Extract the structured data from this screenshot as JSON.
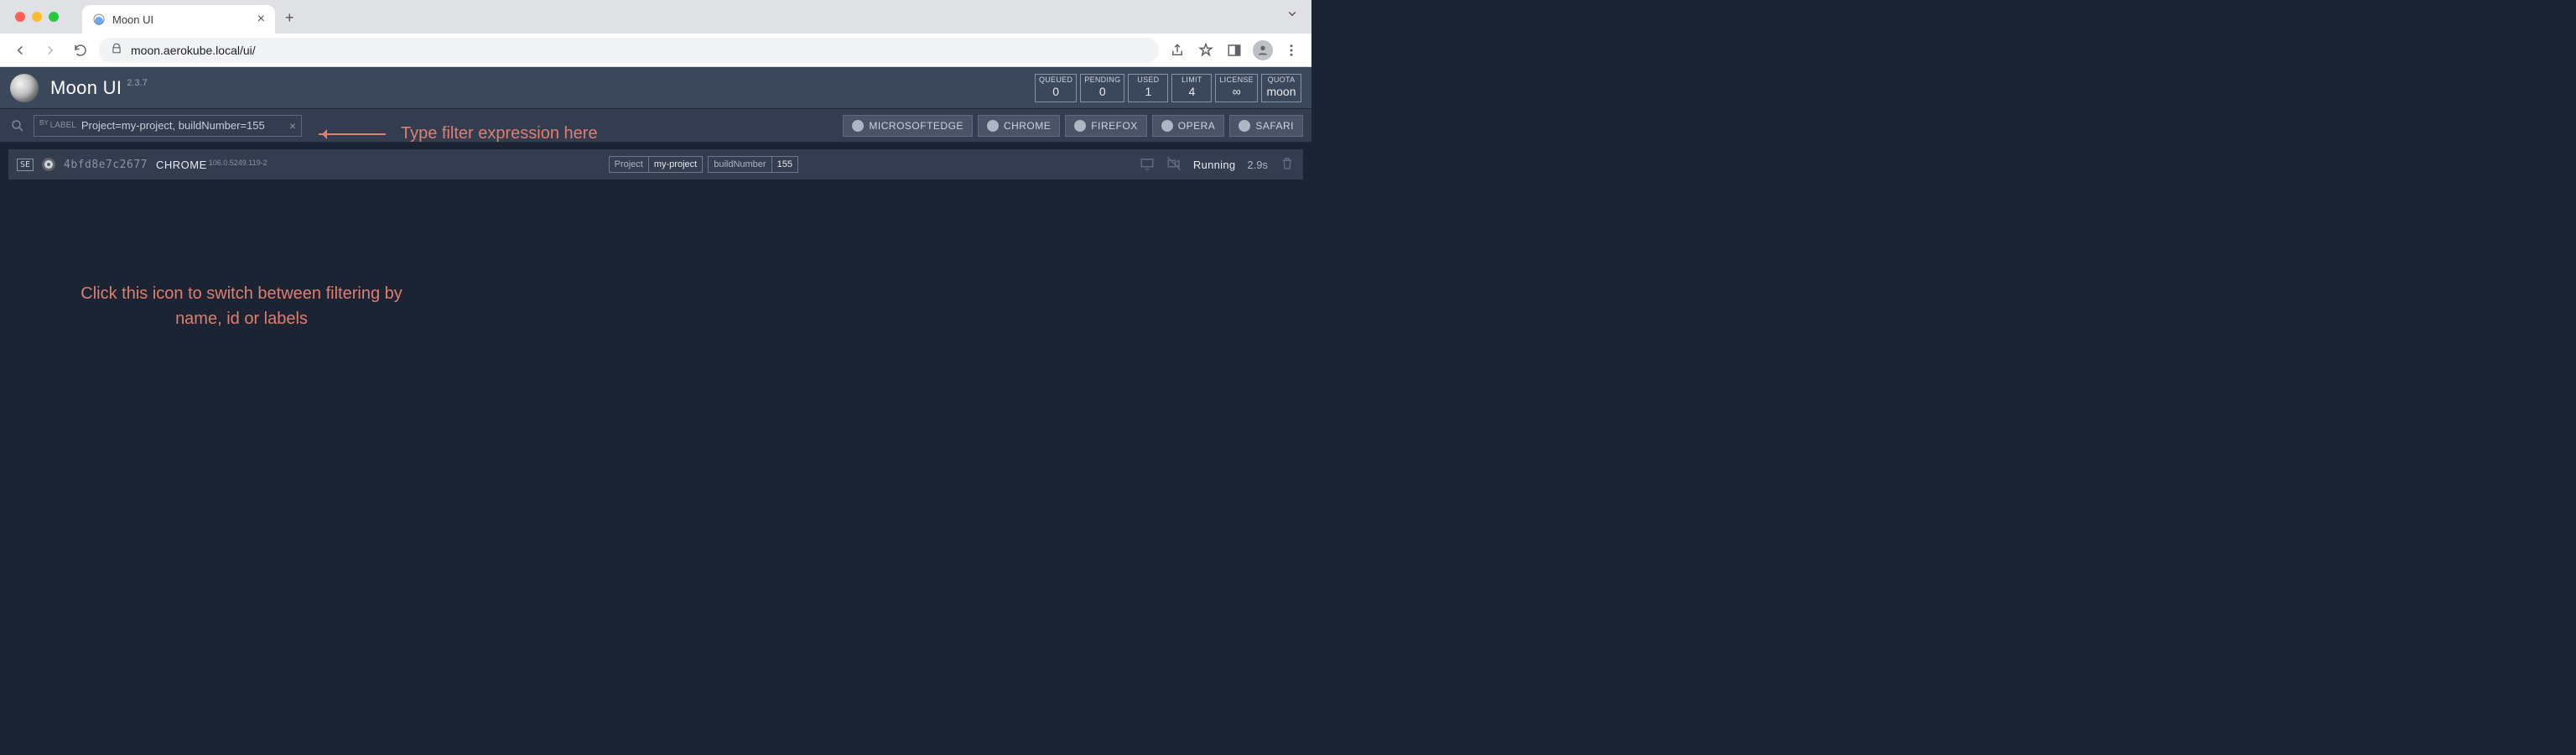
{
  "browser": {
    "tab_title": "Moon UI",
    "url": "moon.aerokube.local/ui/"
  },
  "header": {
    "title": "Moon UI",
    "version": "2.3.7",
    "stats": [
      {
        "label": "QUEUED",
        "value": "0"
      },
      {
        "label": "PENDING",
        "value": "0"
      },
      {
        "label": "USED",
        "value": "1"
      },
      {
        "label": "LIMIT",
        "value": "4"
      },
      {
        "label": "LICENSE",
        "value": "∞"
      },
      {
        "label": "QUOTA",
        "value": "moon"
      }
    ]
  },
  "filter": {
    "prefix_by": "BY",
    "prefix_label": "LABEL",
    "value": "Project=my-project, buildNumber=155",
    "browsers": [
      "MICROSOFTEDGE",
      "CHROME",
      "FIREFOX",
      "OPERA",
      "SAFARI"
    ]
  },
  "session": {
    "se_label": "SE",
    "id": "4bfd8e7c2677",
    "browser_name": "CHROME",
    "browser_version": "106.0.5249.119-2",
    "tags": [
      {
        "k": "Project",
        "v": "my-project"
      },
      {
        "k": "buildNumber",
        "v": "155"
      }
    ],
    "status": "Running",
    "time": "2.9s"
  },
  "annotations": {
    "a1": "Type filter expression here",
    "a2_line1": "Click this icon to switch between filtering by",
    "a2_line2": "name, id or labels"
  }
}
